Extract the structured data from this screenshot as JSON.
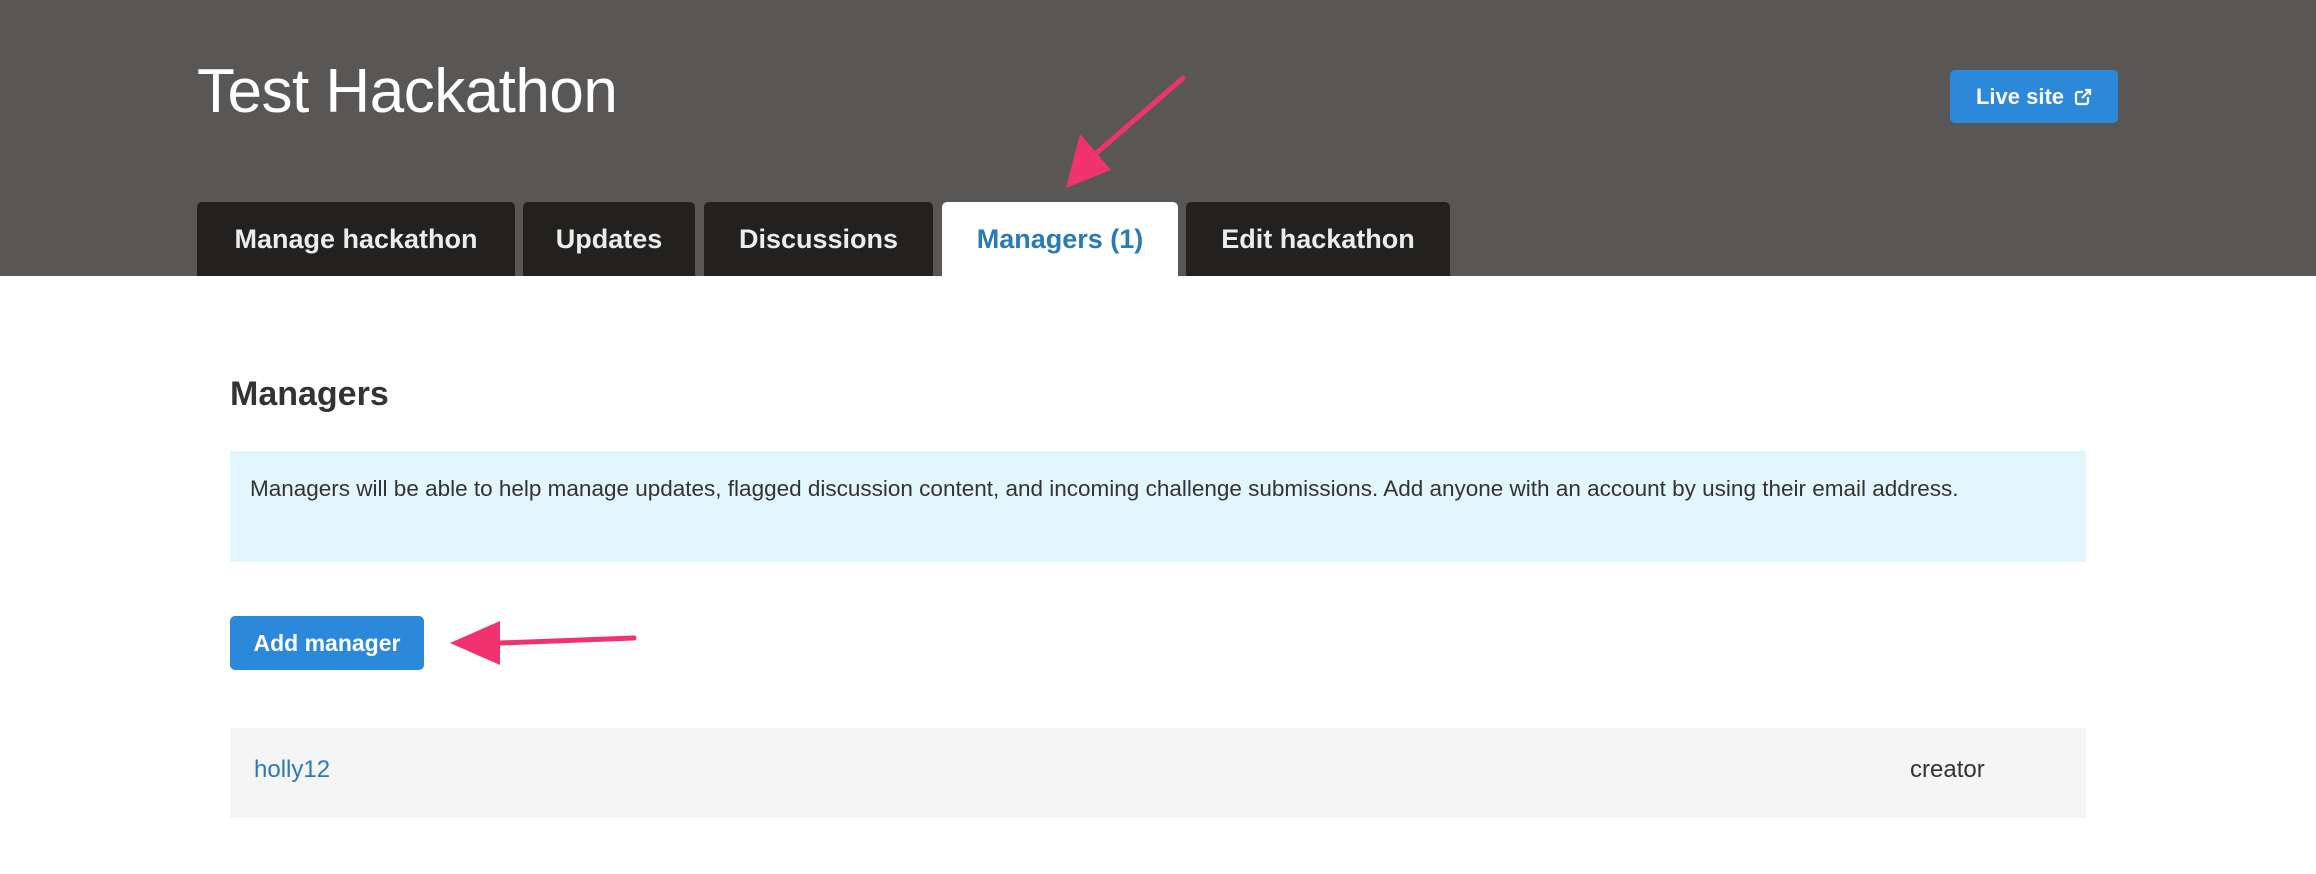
{
  "header": {
    "title": "Test Hackathon",
    "live_site_label": "Live site"
  },
  "tabs": [
    {
      "label": "Manage hackathon",
      "active": false
    },
    {
      "label": "Updates",
      "active": false
    },
    {
      "label": "Discussions",
      "active": false
    },
    {
      "label": "Managers (1)",
      "active": true
    },
    {
      "label": "Edit hackathon",
      "active": false
    }
  ],
  "main": {
    "section_title": "Managers",
    "info_text": "Managers will be able to help manage updates, flagged discussion content, and incoming challenge submissions. Add anyone with an account by using their email address.",
    "add_button_label": "Add manager",
    "managers": [
      {
        "name": "holly12",
        "role": "creator"
      }
    ]
  },
  "colors": {
    "header_bg": "#585756",
    "tab_bg": "#222120",
    "accent_blue": "#2c88d9",
    "link_blue": "#2a7ab8",
    "info_bg": "#e4f6fd",
    "annotation_arrow": "#f0326e"
  },
  "icons": {
    "live_site": "external-link-icon"
  }
}
